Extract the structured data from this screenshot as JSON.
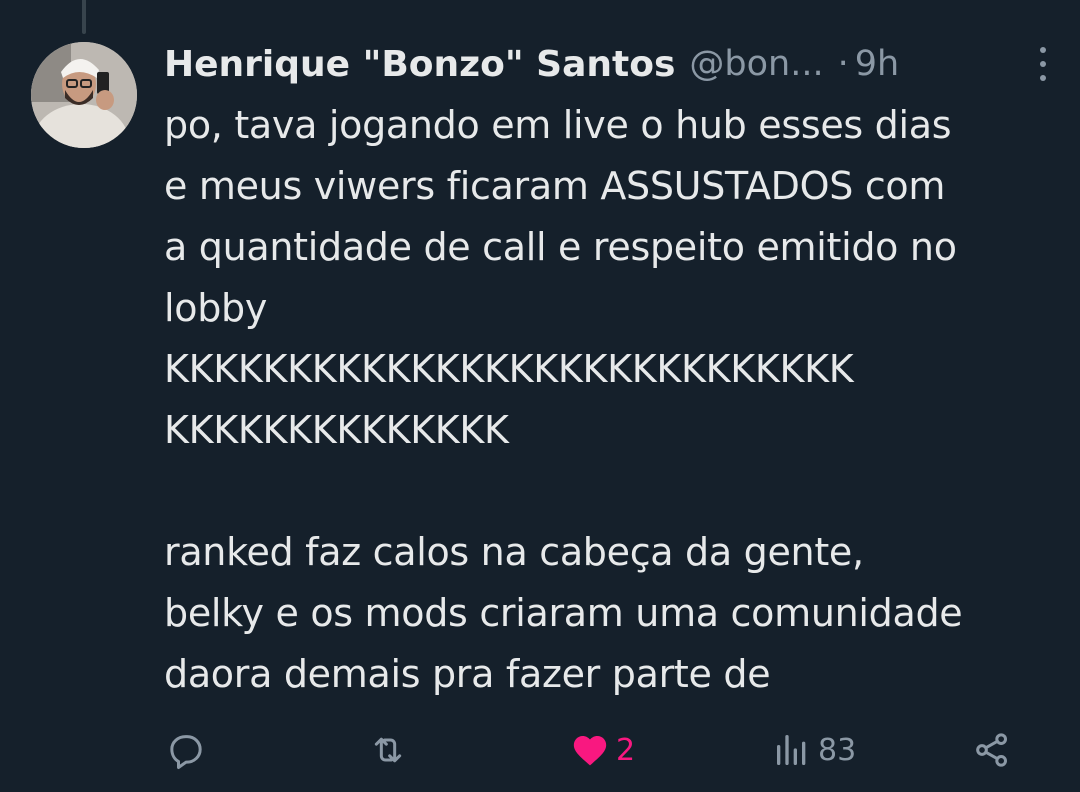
{
  "tweet": {
    "author_name": "Henrique \"Bonzo\" Santos",
    "handle": "@bon...",
    "separator": "·",
    "time": "9h",
    "text": "po, tava jogando em live o hub esses dias\ne meus viwers ficaram ASSUSTADOS com\na quantidade de call e respeito emitido no\nlobby\nKKKKKKKKKKKKKKKKKKKKKKKKKKKK\nKKKKKKKKKKKKKK\n\nranked faz calos na cabeça da gente,\nbelky e os mods criaram uma comunidade\ndaora demais pra fazer parte de"
  },
  "actions": {
    "reply": {
      "icon": "reply-icon",
      "count": ""
    },
    "retweet": {
      "icon": "retweet-icon",
      "count": ""
    },
    "like": {
      "icon": "heart-icon",
      "count": "2",
      "active": true,
      "color": "#f91880"
    },
    "views": {
      "icon": "views-icon",
      "count": "83"
    },
    "share": {
      "icon": "share-icon",
      "count": ""
    }
  },
  "colors": {
    "background": "#15202b",
    "text": "#e7e9ea",
    "secondary": "#8b98a5",
    "like": "#f91880"
  }
}
